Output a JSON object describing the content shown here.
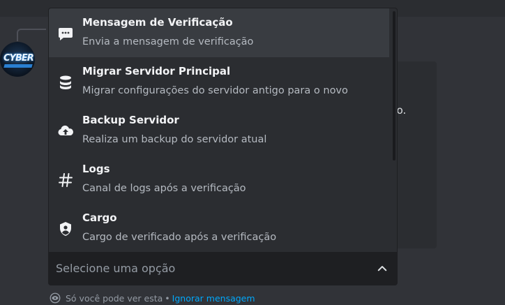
{
  "background_text": {
    "embed_fragment": "ixo."
  },
  "avatar": {
    "text": "CYBER"
  },
  "dropdown": {
    "options": [
      {
        "title": "Mensagem de Verificação",
        "description": "Envia a mensagem de verificação",
        "icon": "chat-bubble-icon"
      },
      {
        "title": "Migrar Servidor Principal",
        "description": "Migrar configurações do servidor antigo para o novo",
        "icon": "database-icon"
      },
      {
        "title": "Backup Servidor",
        "description": "Realiza um backup do servidor atual",
        "icon": "cloud-upload-icon"
      },
      {
        "title": "Logs",
        "description": "Canal de logs após a verificação",
        "icon": "hashtag-icon"
      },
      {
        "title": "Cargo",
        "description": "Cargo de verificado após a verificação",
        "icon": "shield-person-icon"
      }
    ],
    "highlighted_index": 0
  },
  "select": {
    "placeholder": "Selecione uma opção",
    "chevron_icon": "chevron-up-icon"
  },
  "ephemeral": {
    "text": "Só você pode ver esta",
    "separator": "•",
    "dismiss_label": "Ignorar mensagem"
  },
  "colors": {
    "background": "#313338",
    "menu": "#2b2d31",
    "highlight": "#393c41",
    "link": "#00a8fc"
  }
}
